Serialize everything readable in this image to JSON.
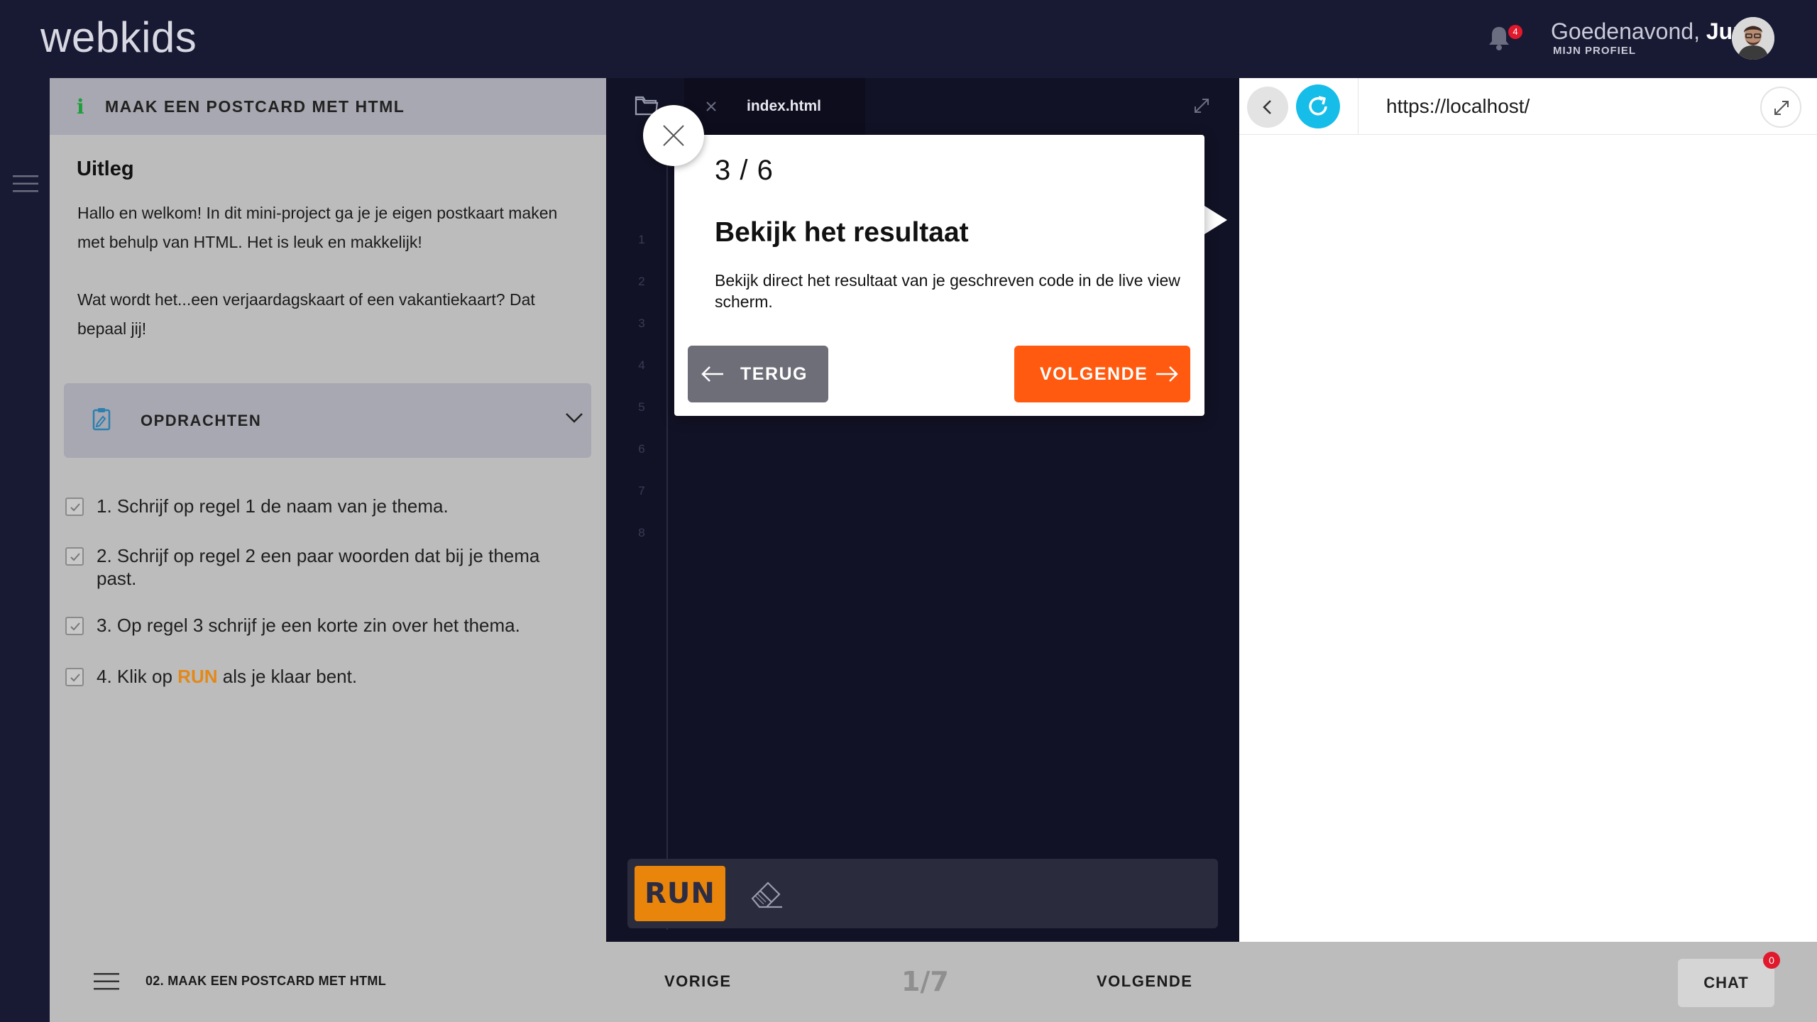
{
  "header": {
    "logo": "webkids",
    "notification_count": "4",
    "greeting": "Goedenavond,",
    "user_name": "Jun",
    "profile_link": "MIJN PROFIEL"
  },
  "instructions": {
    "title": "MAAK EEN POSTCARD MET HTML",
    "uitleg_heading": "Uitleg",
    "paragraphs": [
      "Hallo en welkom! In dit mini-project ga je je eigen postkaart maken met behulp van HTML. Het is leuk en makkelijk!",
      "Wat wordt het...een verjaardagskaart of een vakantiekaart? Dat bepaal jij!"
    ],
    "tasks_label": "OPDRACHTEN",
    "tasks": [
      {
        "text": "1. Schrijf op regel 1 de naam van je thema.",
        "checked": true
      },
      {
        "text": "2. Schrijf op regel 2 een paar woorden dat bij je thema past.",
        "checked": true
      },
      {
        "text": "3. Op regel 3 schrijf je een korte zin over het thema.",
        "checked": true
      },
      {
        "text_before": "4. Klik op ",
        "highlight": "RUN",
        "text_after": " als je klaar bent.",
        "checked": true
      }
    ]
  },
  "editor": {
    "file_name": "index.html",
    "line_numbers": [
      "1",
      "2",
      "3",
      "4",
      "5",
      "6",
      "7",
      "8"
    ],
    "run_label": "RUN",
    "icons": [
      "folder-icon",
      "close-icon",
      "expand-icon",
      "eraser-icon"
    ]
  },
  "preview": {
    "url": "https://localhost/",
    "icons": [
      "chevron-left-icon",
      "refresh-icon",
      "expand-icon"
    ],
    "refresh_color": "#15bde8"
  },
  "tour": {
    "step": "3 / 6",
    "title": "Bekijk het resultaat",
    "body": "Bekijk direct het resultaat van je geschreven code in de live view scherm.",
    "back_label": "TERUG",
    "next_label": "VOLGENDE",
    "next_color": "#ff5a0f",
    "back_color": "#6e6e78"
  },
  "footer": {
    "course": "02. MAAK EEN POSTCARD MET HTML",
    "prev_label": "VORIGE",
    "page": "1/7",
    "next_label": "VOLGENDE",
    "chat_label": "CHAT",
    "chat_badge": "0"
  },
  "colors": {
    "header_bg": "#181933",
    "editor_bg": "#121226",
    "accent_orange": "#e8850a",
    "panel_bg": "#bcbcbc"
  }
}
